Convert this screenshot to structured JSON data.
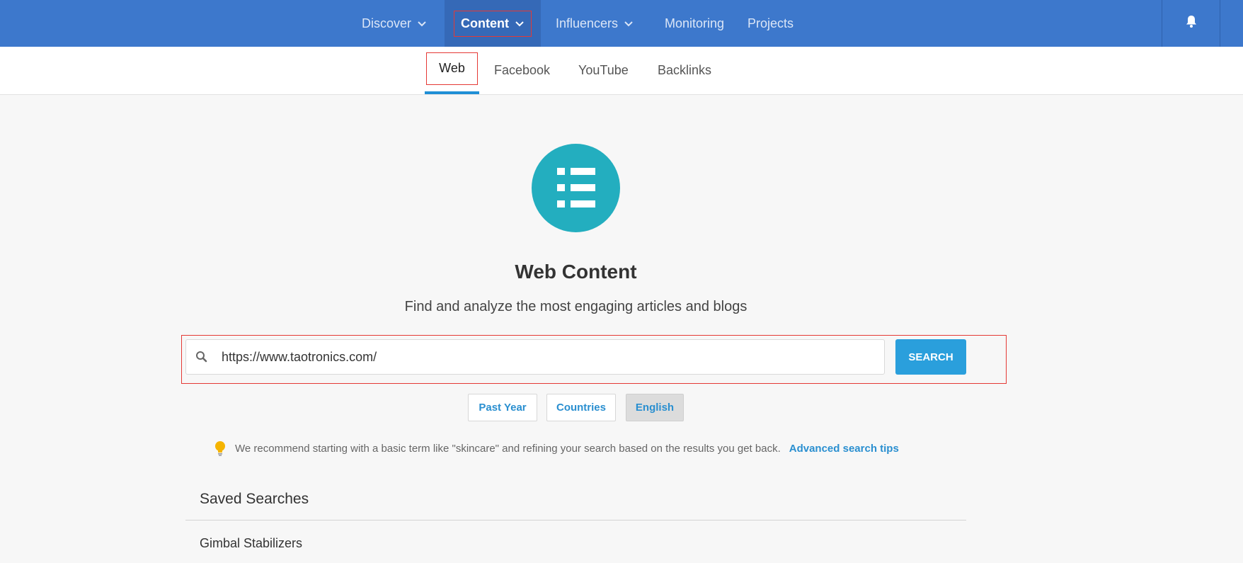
{
  "topnav": {
    "items": [
      {
        "label": "Discover",
        "dropdown": true
      },
      {
        "label": "Content",
        "dropdown": true,
        "active": true
      },
      {
        "label": "Influencers",
        "dropdown": true
      },
      {
        "label": "Monitoring",
        "dropdown": false
      },
      {
        "label": "Projects",
        "dropdown": false
      }
    ],
    "bell_icon": "bell-icon",
    "bar_color": "#3d78cc"
  },
  "subnav": {
    "tabs": [
      {
        "label": "Web",
        "active": true
      },
      {
        "label": "Facebook"
      },
      {
        "label": "YouTube"
      },
      {
        "label": "Backlinks"
      }
    ],
    "active_color": "#1f8fd6"
  },
  "hero": {
    "icon": "list-icon",
    "icon_color": "#23aebf",
    "title": "Web Content",
    "subtitle": "Find and analyze the most engaging articles and blogs"
  },
  "search": {
    "value": "https://www.taotronics.com/",
    "button_label": "SEARCH",
    "icon": "search-icon"
  },
  "filters": [
    {
      "label": "Past Year"
    },
    {
      "label": "Countries"
    },
    {
      "label": "English",
      "selected": true
    }
  ],
  "tip": {
    "icon": "lightbulb-icon",
    "text": "We recommend starting with a basic term like \"skincare\" and refining your search based on the results you get back.",
    "link_label": "Advanced search tips"
  },
  "saved": {
    "title": "Saved Searches",
    "items": [
      {
        "label": "Gimbal Stabilizers"
      }
    ]
  }
}
